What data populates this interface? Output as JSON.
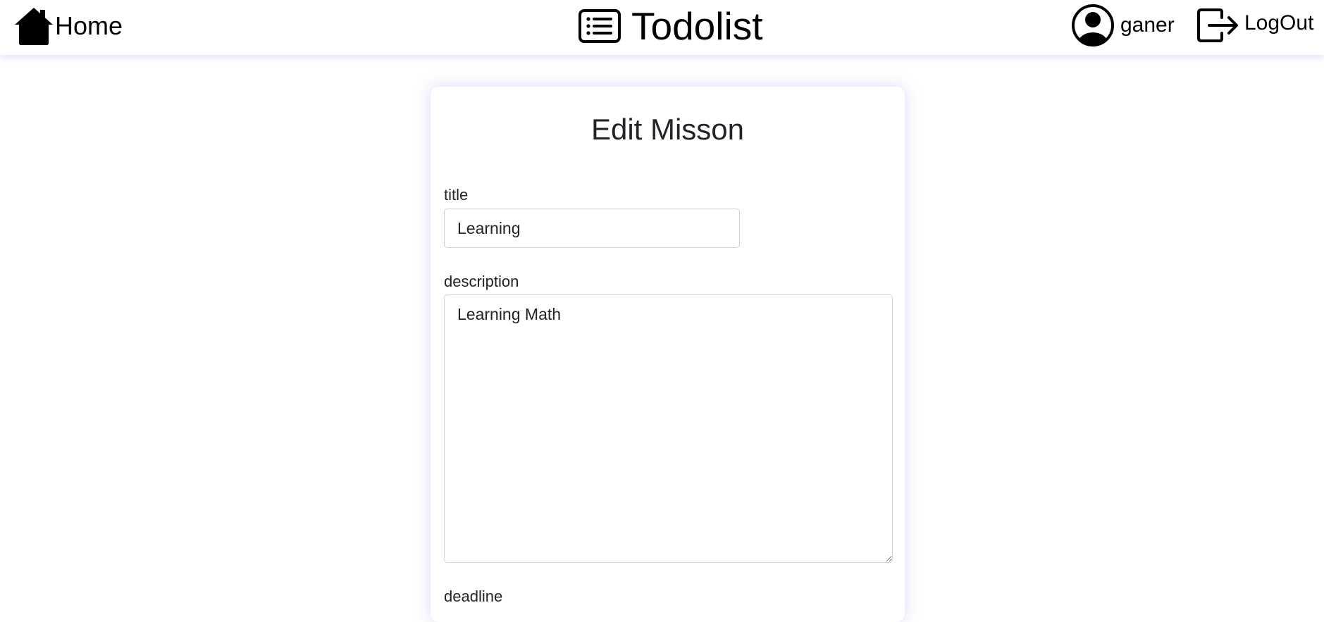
{
  "navbar": {
    "home_label": "Home",
    "brand_label": "Todolist",
    "username": "ganer",
    "logout_label": "LogOut",
    "icons": {
      "home": "house-icon",
      "brand": "list-icon",
      "user": "user-circle-icon",
      "logout": "logout-icon"
    }
  },
  "form": {
    "heading": "Edit Misson",
    "title_label": "title",
    "title_value": "Learning",
    "description_label": "description",
    "description_value": "Learning Math",
    "deadline_label": "deadline"
  }
}
